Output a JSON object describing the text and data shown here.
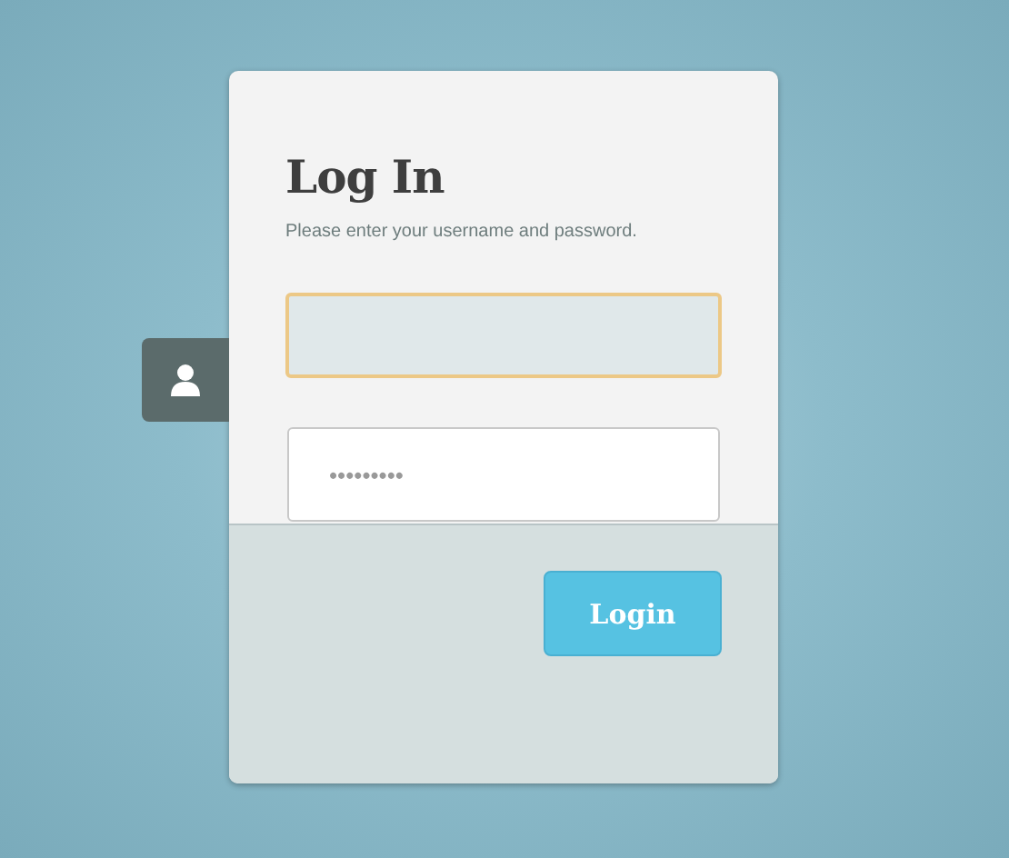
{
  "title": "Log In",
  "subtitle": "Please enter your username and password.",
  "fields": [
    {
      "kind": "username",
      "focused": true
    },
    {
      "kind": "password",
      "value": "•••••••••",
      "focused": false
    }
  ],
  "button": "Login"
}
